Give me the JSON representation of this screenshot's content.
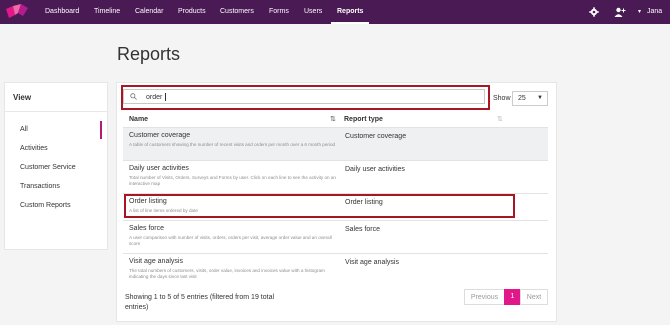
{
  "nav": {
    "items": [
      "Dashboard",
      "Timeline",
      "Calendar",
      "Products",
      "Customers",
      "Forms",
      "Users",
      "Reports"
    ],
    "active": "Reports",
    "user": "Jana"
  },
  "page_title": "Reports",
  "view": {
    "title": "View",
    "items": [
      "All",
      "Activities",
      "Customer Service",
      "Transactions",
      "Custom Reports"
    ]
  },
  "search": {
    "value": "order",
    "placeholder": ""
  },
  "show": {
    "label": "Show",
    "value": "25"
  },
  "table": {
    "headers": [
      "Name",
      "Report type"
    ],
    "rows": [
      {
        "name": "Customer coverage",
        "desc": "A table of customers showing the number of recent visits and orders per month over a 6 month period",
        "type": "Customer coverage"
      },
      {
        "name": "Daily user activities",
        "desc": "Total number of Visits, Orders, Surveys and Forms by user. Click on each line to see the activity on an interactive map",
        "type": "Daily user activities"
      },
      {
        "name": "Order listing",
        "desc": "A list of line items ordered by date",
        "type": "Order listing"
      },
      {
        "name": "Sales force",
        "desc": "A user comparison with number of visits, orders, orders per visit, average order value and an overall score",
        "type": "Sales force"
      },
      {
        "name": "Visit age analysis",
        "desc": "The total numbers of customers, visits, order value, invoices and invoices value with a histogram indicating the days since last visit",
        "type": "Visit age analysis"
      }
    ]
  },
  "footer": {
    "info": "Showing 1 to 5 of 5 entries (filtered from 19 total entries)"
  },
  "pagination": {
    "prev": "Previous",
    "page": "1",
    "next": "Next"
  },
  "colors": {
    "nav_bg": "#4a1a54",
    "accent": "#e2178a",
    "highlight": "#a81624"
  }
}
